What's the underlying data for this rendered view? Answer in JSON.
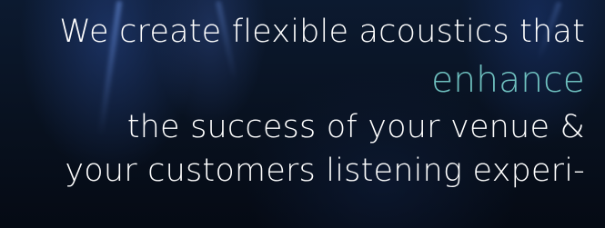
{
  "hero": {
    "line1": "We create flexible acoustics that",
    "accent": "enhance",
    "line3": "the success of your venue &",
    "line4": "your customers listening experi-"
  },
  "colors": {
    "text": "#ffffff",
    "accent": "#6fc1c0",
    "background": "#0a1220"
  }
}
